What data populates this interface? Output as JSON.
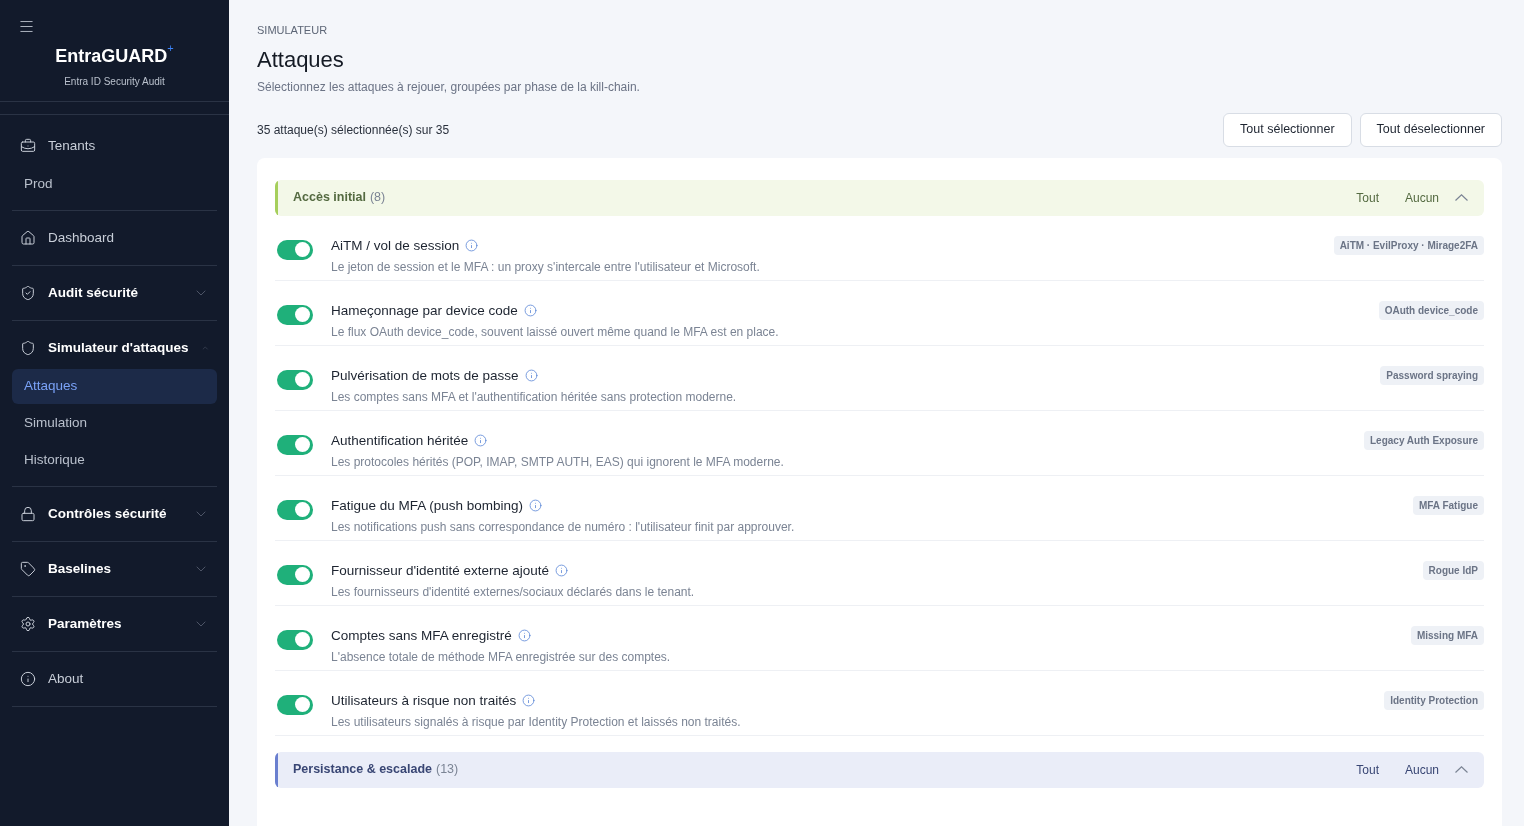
{
  "sidebar": {
    "brand": "EntraGUARD",
    "brand_mark": "+",
    "subtitle": "Entra ID Security Audit",
    "sections": [
      {
        "kind": "link",
        "label": "Tenants",
        "children": [
          {
            "label": "Prod",
            "selected": false
          }
        ]
      },
      {
        "kind": "link",
        "label": "Dashboard"
      },
      {
        "kind": "group",
        "label": "Audit sécurité",
        "expanded": false
      },
      {
        "kind": "group",
        "label": "Simulateur d'attaques",
        "expanded": true,
        "children": [
          {
            "label": "Attaques",
            "selected": true
          },
          {
            "label": "Simulation",
            "selected": false
          },
          {
            "label": "Historique",
            "selected": false
          }
        ]
      },
      {
        "kind": "group",
        "label": "Contrôles sécurité",
        "expanded": false
      },
      {
        "kind": "group",
        "label": "Baselines",
        "expanded": false
      },
      {
        "kind": "group",
        "label": "Paramètres",
        "expanded": false
      },
      {
        "kind": "link",
        "label": "About"
      }
    ]
  },
  "page": {
    "eyebrow": "SIMULATEUR",
    "title": "Attaques",
    "subtitle": "Sélectionnez les attaques à rejouer, groupées par phase de la kill-chain.",
    "count": "35 attaque(s) sélectionnée(s) sur 35",
    "buttons": [
      "Tout sélectionner",
      "Tout déselectionner"
    ]
  },
  "groups": [
    {
      "name": "Accès initial",
      "count": "(8)",
      "color": "#a6cf5c",
      "all": "Tout",
      "none": "Aucun",
      "expanded": true,
      "attacks": [
        {
          "title": "AiTM / vol de session",
          "description": "Le jeton de session et le MFA : un proxy s'intercale entre l'utilisateur et Microsoft.",
          "tag": "AiTM · EvilProxy · Mirage2FA",
          "on": true
        },
        {
          "title": "Hameçonnage par device code",
          "description": "Le flux OAuth device_code, souvent laissé ouvert même quand le MFA est en place.",
          "tag": "OAuth device_code",
          "on": true
        },
        {
          "title": "Pulvérisation de mots de passe",
          "description": "Les comptes sans MFA et l'authentification héritée sans protection moderne.",
          "tag": "Password spraying",
          "on": true
        },
        {
          "title": "Authentification héritée",
          "description": "Les protocoles hérités (POP, IMAP, SMTP AUTH, EAS) qui ignorent le MFA moderne.",
          "tag": "Legacy Auth Exposure",
          "on": true
        },
        {
          "title": "Fatigue du MFA (push bombing)",
          "description": "Les notifications push sans correspondance de numéro : l'utilisateur finit par approuver.",
          "tag": "MFA Fatigue",
          "on": true
        },
        {
          "title": "Fournisseur d'identité externe ajouté",
          "description": "Les fournisseurs d'identité externes/sociaux déclarés dans le tenant.",
          "tag": "Rogue IdP",
          "on": true
        },
        {
          "title": "Comptes sans MFA enregistré",
          "description": "L'absence totale de méthode MFA enregistrée sur des comptes.",
          "tag": "Missing MFA",
          "on": true
        },
        {
          "title": "Utilisateurs à risque non traités",
          "description": "Les utilisateurs signalés à risque par Identity Protection et laissés non traités.",
          "tag": "Identity Protection",
          "on": true
        }
      ]
    },
    {
      "name": "Persistance & escalade",
      "count": "(13)",
      "color": "#6a7fcf",
      "all": "Tout",
      "none": "Aucun",
      "expanded": true
    }
  ]
}
